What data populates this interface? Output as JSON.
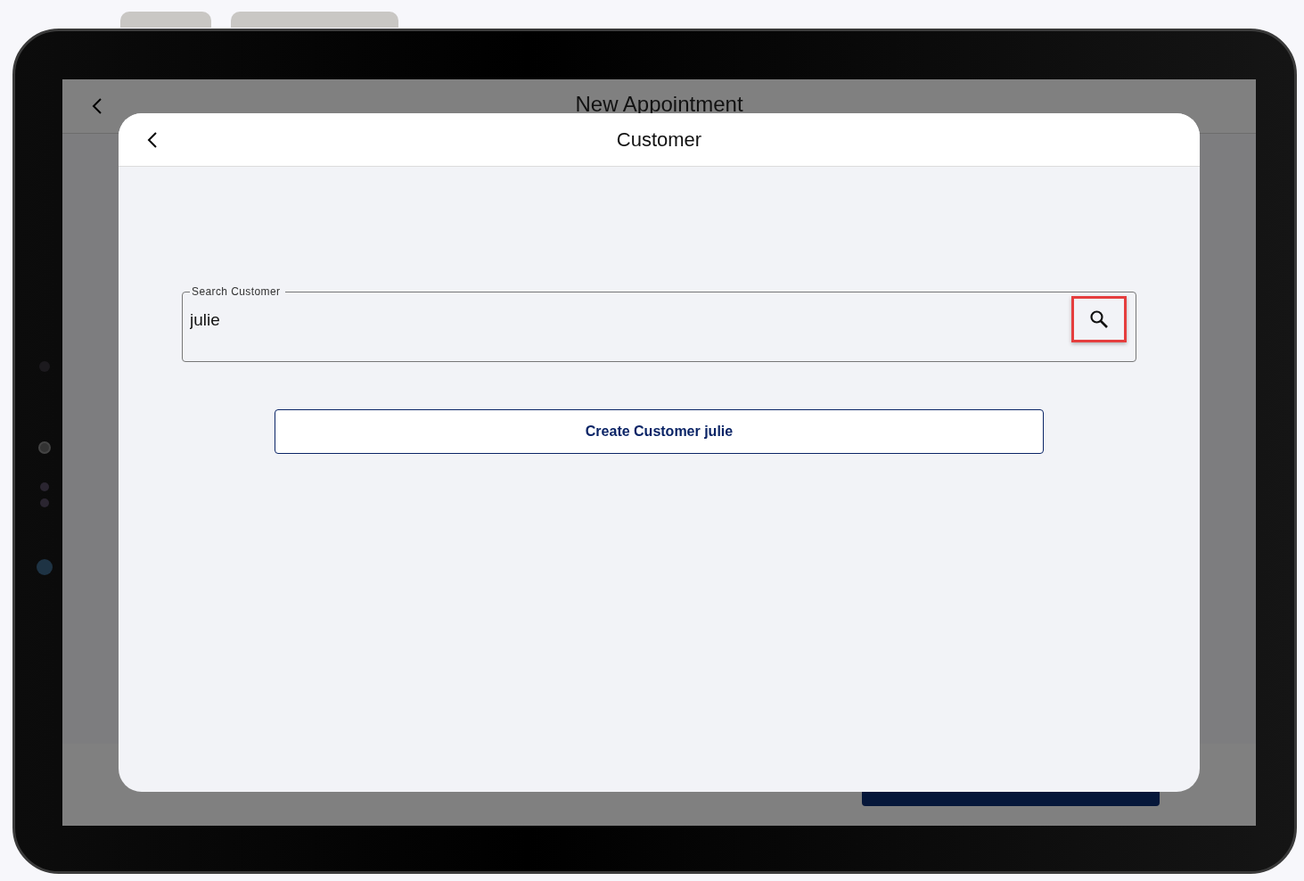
{
  "background_screen": {
    "title": "New Appointment"
  },
  "dialog": {
    "title": "Customer",
    "search": {
      "label": "Search Customer",
      "value": "julie",
      "search_highlighted": true
    },
    "create_button": "Create Customer julie"
  }
}
